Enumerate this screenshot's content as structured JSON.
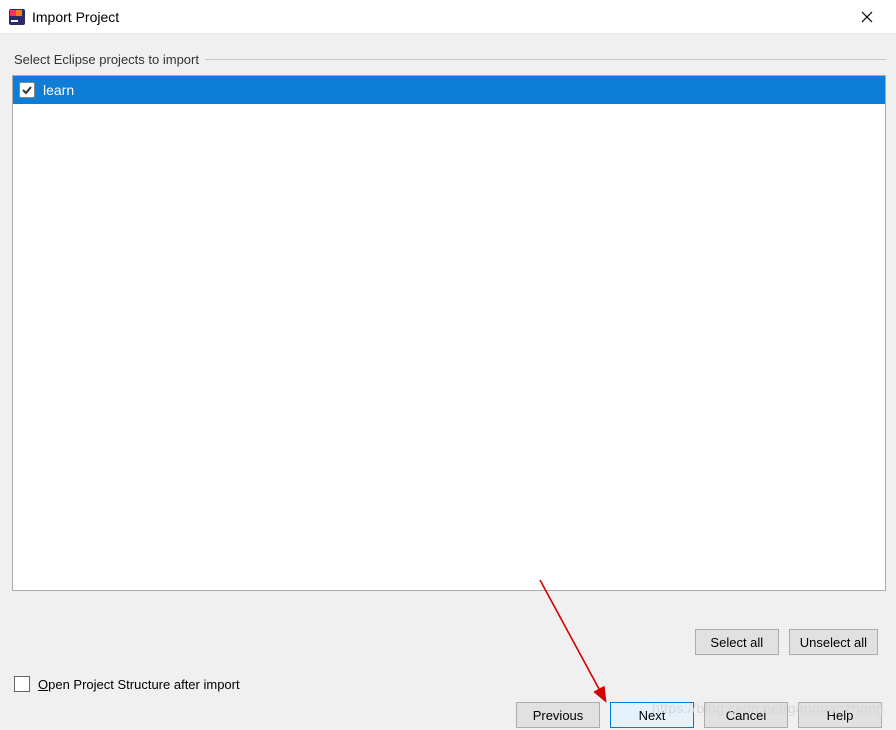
{
  "window": {
    "title": "Import Project"
  },
  "section": {
    "label": "Select Eclipse projects to import"
  },
  "projects": {
    "items": [
      {
        "label": "learn",
        "checked": true,
        "selected": true
      }
    ]
  },
  "selection_buttons": {
    "select_all": "Select all",
    "unselect_all": "Unselect all"
  },
  "open_structure": {
    "label_prefix": "O",
    "label_rest": "pen Project Structure after import",
    "checked": false
  },
  "wizard_buttons": {
    "previous": "Previous",
    "next": "Next",
    "cancel": "Cancel",
    "help": "Help"
  },
  "watermark": "https://blog.csdn.net/ganquanzhong",
  "colors": {
    "selection": "#0d7dd8",
    "button_bg": "#e1e1e1",
    "button_border": "#adadad",
    "default_border": "#0078d7"
  }
}
